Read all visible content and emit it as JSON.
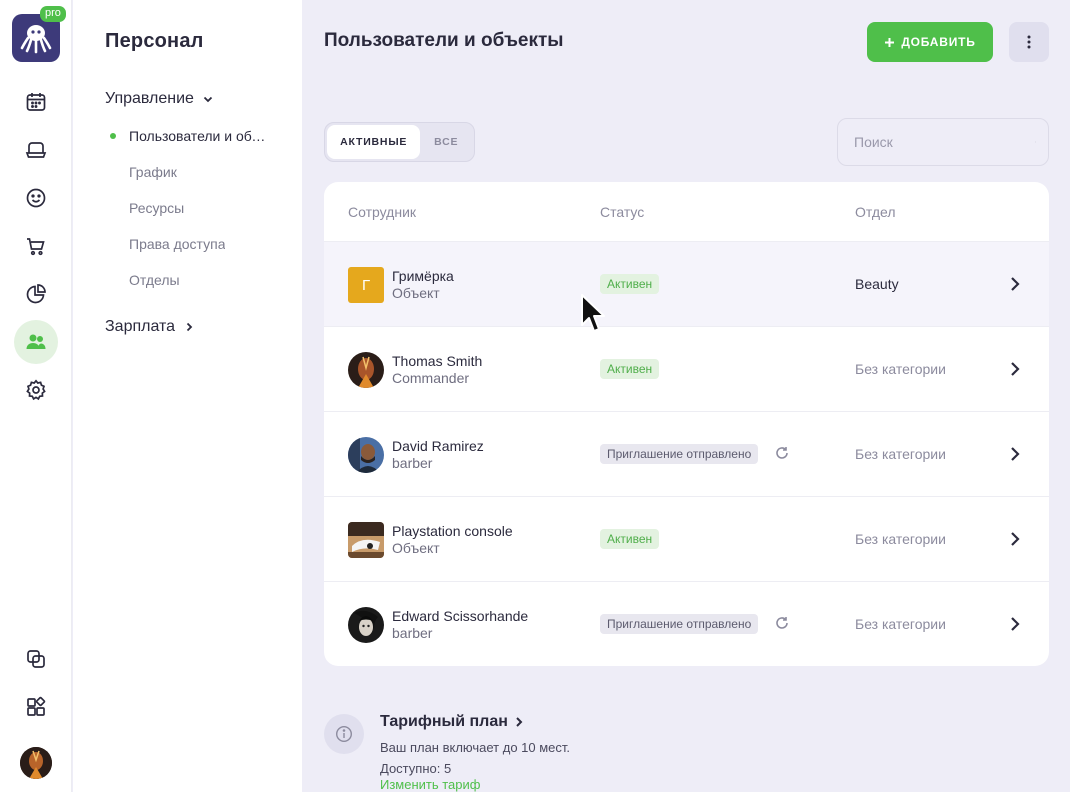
{
  "app": {
    "badge": "pro",
    "section_title": "Персонал"
  },
  "subnav": {
    "management": "Управление",
    "items": [
      {
        "label": "Пользователи и объекты"
      },
      {
        "label": "График"
      },
      {
        "label": "Ресурсы"
      },
      {
        "label": "Права доступа"
      },
      {
        "label": "Отделы"
      }
    ],
    "salary": "Зарплата"
  },
  "header": {
    "title": "Пользователи и объекты",
    "add_label": "ДОБАВИТЬ"
  },
  "filters": {
    "active": "АКТИВНЫЕ",
    "all": "ВСЕ",
    "search_placeholder": "Поиск"
  },
  "table": {
    "columns": [
      "Сотрудник",
      "Статус",
      "Отдел"
    ],
    "rows": [
      {
        "initial": "Г",
        "name": "Гримёрка",
        "role": "Объект",
        "status": "Активен",
        "status_kind": "active",
        "department": "Beauty"
      },
      {
        "name": "Thomas Smith",
        "role": "Commander",
        "status": "Активен",
        "status_kind": "active",
        "department": "Без категории"
      },
      {
        "name": "David Ramirez",
        "role": "barber",
        "status": "Приглашение отправлено",
        "status_kind": "invited",
        "department": "Без категории"
      },
      {
        "name": "Playstation console",
        "role": "Объект",
        "status": "Активен",
        "status_kind": "active",
        "department": "Без категории"
      },
      {
        "name": "Edward Scissorhande",
        "role": "barber",
        "status": "Приглашение отправлено",
        "status_kind": "invited",
        "department": "Без категории"
      }
    ]
  },
  "plan": {
    "title": "Тарифный план",
    "description": "Ваш план включает до 10 мест. Доступно: 5",
    "link": "Изменить тариф"
  },
  "colors": {
    "accent": "#4fbf4a",
    "brand": "#3d3a7a",
    "background": "#eeedf7"
  },
  "icons": [
    "calendar-icon",
    "bell-desk-icon",
    "smiley-icon",
    "cart-icon",
    "pie-chart-icon",
    "users-icon",
    "gear-icon",
    "copy-icon",
    "widgets-icon"
  ]
}
